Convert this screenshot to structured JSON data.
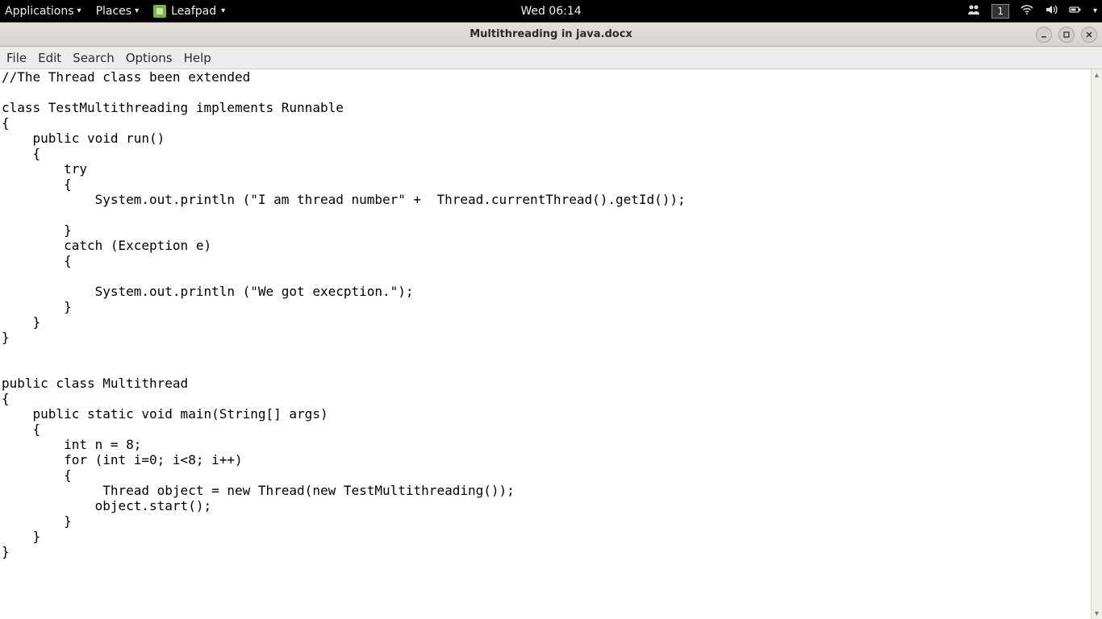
{
  "panel": {
    "applications": "Applications",
    "places": "Places",
    "app_name": "Leafpad",
    "clock": "Wed 06:14",
    "workspace": "1"
  },
  "window": {
    "title": "Multithreading in java.docx"
  },
  "menubar": {
    "file": "File",
    "edit": "Edit",
    "search": "Search",
    "options": "Options",
    "help": "Help"
  },
  "editor": {
    "content": "//The Thread class been extended\n\nclass TestMultithreading implements Runnable\n{\n    public void run()\n    {\n        try\n        {\n            System.out.println (\"I am thread number\" +  Thread.currentThread().getId());\n\n        }\n        catch (Exception e)\n        {\n\n            System.out.println (\"We got execption.\");\n        }\n    }\n}\n\n\npublic class Multithread\n{\n    public static void main(String[] args)\n    {\n        int n = 8;\n        for (int i=0; i<8; i++)\n        {\n             Thread object = new Thread(new TestMultithreading());\n            object.start();\n        }\n    }\n}"
  }
}
